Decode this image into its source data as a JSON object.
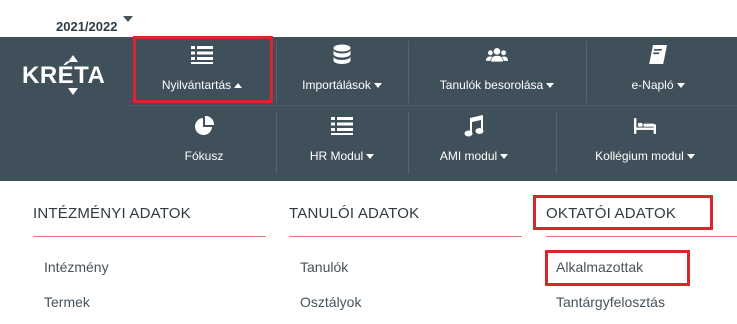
{
  "school_year": {
    "value": "2021/2022"
  },
  "brand": {
    "logo_text": "KRÉTA",
    "colors": {
      "nav_background": "#3f505b",
      "highlight": "#d9262b",
      "section_underline": "#e07b73"
    }
  },
  "nav": {
    "row1": [
      {
        "label": "Nyilvántartás",
        "icon": "list-icon",
        "state": "expanded"
      },
      {
        "label": "Importálások",
        "icon": "database-icon",
        "state": "collapsed"
      },
      {
        "label": "Tanulók besorolása",
        "icon": "users-icon",
        "state": "collapsed"
      },
      {
        "label": "e-Napló",
        "icon": "book-icon",
        "state": "collapsed"
      }
    ],
    "row2": [
      {
        "label": "Fókusz",
        "icon": "pie-chart-icon"
      },
      {
        "label": "HR Modul",
        "icon": "list-icon",
        "state": "collapsed"
      },
      {
        "label": "AMI modul",
        "icon": "music-icon",
        "state": "collapsed"
      },
      {
        "label": "Kollégium modul",
        "icon": "bed-icon",
        "state": "collapsed"
      }
    ]
  },
  "menu": {
    "columns": [
      {
        "heading": "INTÉZMÉNYI ADATOK",
        "items": [
          "Intézmény",
          "Termek"
        ]
      },
      {
        "heading": "TANULÓI ADATOK",
        "items": [
          "Tanulók",
          "Osztályok"
        ]
      },
      {
        "heading": "OKTATÓI ADATOK",
        "items": [
          "Alkalmazottak",
          "Tantárgyfelosztás"
        ]
      }
    ]
  }
}
